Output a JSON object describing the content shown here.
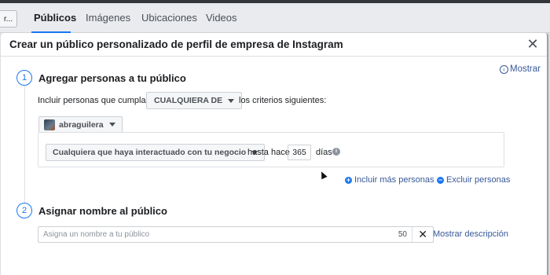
{
  "tabs": {
    "prev_label": "r...",
    "items": [
      "Públicos",
      "Imágenes",
      "Ubicaciones",
      "Videos"
    ],
    "active_index": 0
  },
  "modal": {
    "title": "Crear un público personalizado de perfil de empresa de Instagram",
    "close_icon": "close-icon",
    "show_link": "Mostrar"
  },
  "step1": {
    "number": "1",
    "title": "Agregar personas a tu público",
    "include_prefix": "Incluir personas que cumplan",
    "match_select": "CUALQUIERA DE",
    "include_suffix": "los criterios siguientes:",
    "account_name": "abraguilera",
    "interaction_select": "Cualquiera que haya interactuado con tu negocio",
    "within_label": "hasta hace",
    "days_value": "365",
    "days_label": "días",
    "include_more": "Incluir más personas",
    "exclude": "Excluir personas"
  },
  "step2": {
    "number": "2",
    "title": "Asignar nombre al público",
    "name_placeholder": "Asigna un nombre a tu público",
    "char_count": "50",
    "show_description": "Mostrar descripción"
  },
  "colors": {
    "accent": "#1877f2",
    "link": "#385898"
  }
}
